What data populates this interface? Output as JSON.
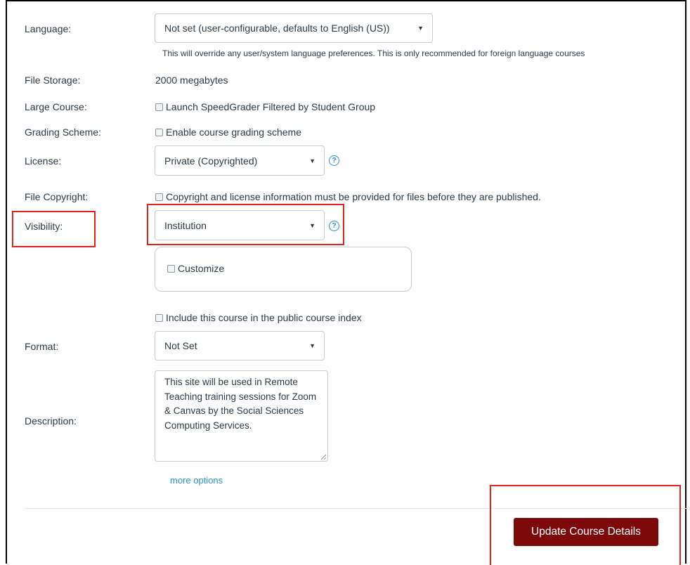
{
  "settings": {
    "language": {
      "label": "Language:",
      "value": "Not set (user-configurable, defaults to English (US))",
      "note": "This will override any user/system language preferences. This is only recommended for foreign language courses"
    },
    "file_storage": {
      "label": "File Storage:",
      "value": "2000 megabytes"
    },
    "large_course": {
      "label": "Large Course:",
      "checkbox_label": "Launch SpeedGrader Filtered by Student Group",
      "checked": false
    },
    "grading_scheme": {
      "label": "Grading Scheme:",
      "checkbox_label": "Enable course grading scheme",
      "checked": false
    },
    "license": {
      "label": "License:",
      "value": "Private (Copyrighted)"
    },
    "file_copyright": {
      "label": "File Copyright:",
      "checkbox_label": "Copyright and license information must be provided for files before they are published.",
      "checked": false
    },
    "visibility": {
      "label": "Visibility:",
      "value": "Institution",
      "customize_label": "Customize",
      "public_index_label": "Include this course in the public course index"
    },
    "format": {
      "label": "Format:",
      "value": "Not Set"
    },
    "description": {
      "label": "Description:",
      "value": "This site will be used in Remote Teaching training sessions for Zoom & Canvas by the Social Sciences Computing Services."
    }
  },
  "more_options_label": "more options",
  "submit_label": "Update Course Details",
  "help_icon_glyph": "?",
  "caret_glyph": "▼",
  "colors": {
    "primary_button": "#7c0a0a",
    "link": "#2a8fd8",
    "highlight": "#e0231d"
  }
}
